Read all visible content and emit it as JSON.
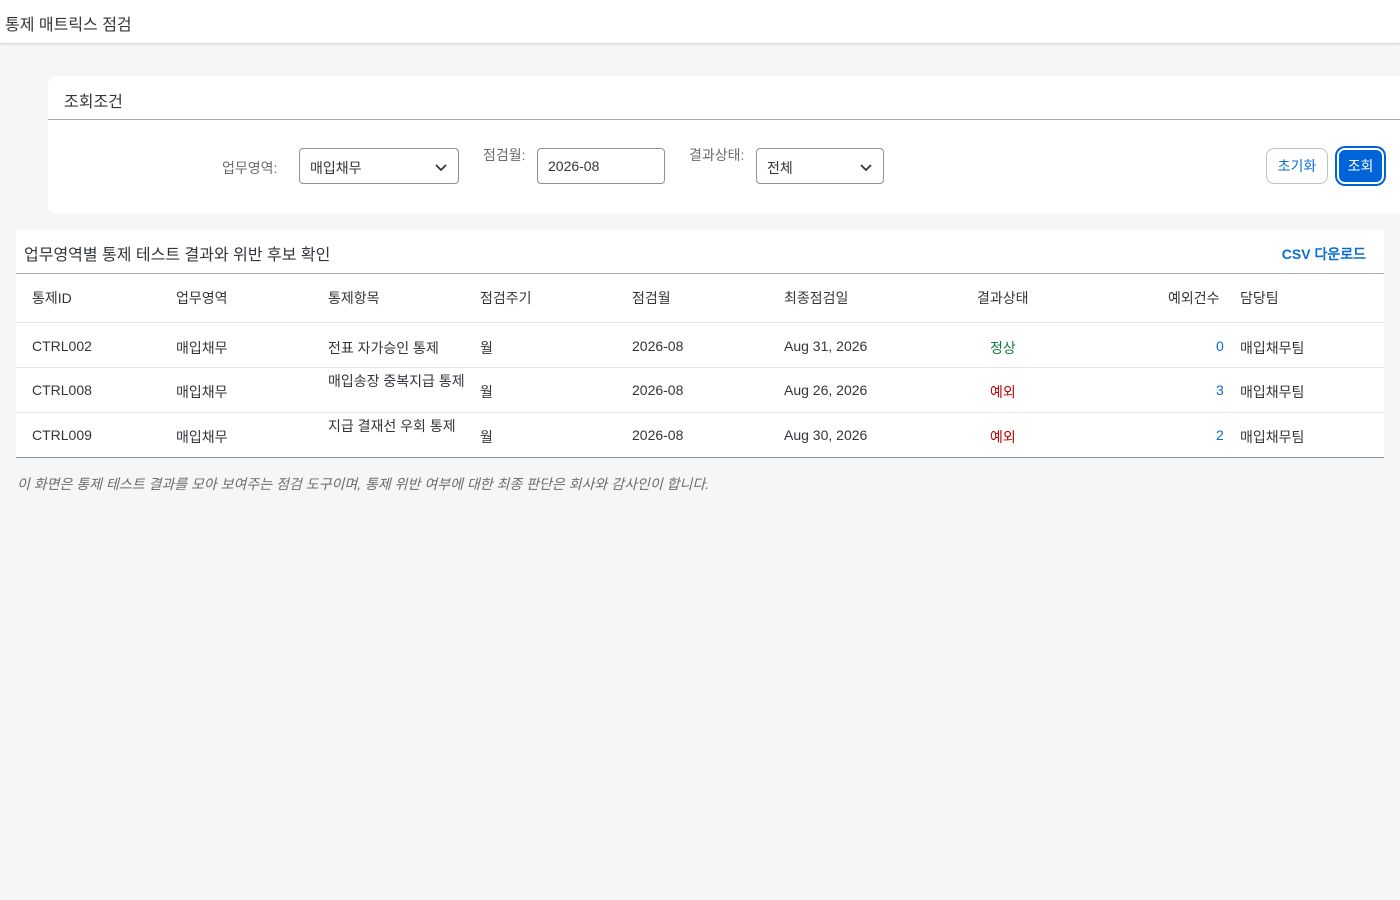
{
  "app": {
    "title": "통제 매트릭스 점검"
  },
  "filters": {
    "title": "조회조건",
    "area": {
      "label": "업무영역:",
      "value": "매입채무"
    },
    "month": {
      "label": "점검월:",
      "value": "2026-08"
    },
    "status": {
      "label": "결과상태:",
      "value": "전체"
    },
    "reset_label": "초기화",
    "search_label": "조회"
  },
  "table": {
    "title": "업무영역별 통제 테스트 결과와 위반 후보 확인",
    "csv_label": "CSV 다운로드",
    "columns": [
      "통제ID",
      "업무영역",
      "통제항목",
      "점검주기",
      "점검월",
      "최종점검일",
      "결과상태",
      "예외건수",
      "담당팀"
    ],
    "rows": [
      {
        "id": "CTRL002",
        "area": "매입채무",
        "item": "전표 자가승인 통제",
        "cycle": "월",
        "month": "2026-08",
        "last": "Aug 31, 2026",
        "status": "정상",
        "exceptions": "0",
        "team": "매입채무팀"
      },
      {
        "id": "CTRL008",
        "area": "매입채무",
        "item": "매입송장 중복지급 통제",
        "cycle": "월",
        "month": "2026-08",
        "last": "Aug 26, 2026",
        "status": "예외",
        "exceptions": "3",
        "team": "매입채무팀"
      },
      {
        "id": "CTRL009",
        "area": "매입채무",
        "item": "지급 결재선 우회 통제",
        "cycle": "월",
        "month": "2026-08",
        "last": "Aug 30, 2026",
        "status": "예외",
        "exceptions": "2",
        "team": "매입채무팀"
      }
    ]
  },
  "footnote": "이 화면은 통제 테스트 결과를 모아 보여주는 점검 도구이며, 통제 위반 여부에 대한 최종 판단은 회사와 감사인이 합니다.",
  "colors": {
    "accent": "#0a6ed1",
    "primary_button": "#0064d9",
    "ok": "#107e3e",
    "exception": "#bb0000"
  }
}
